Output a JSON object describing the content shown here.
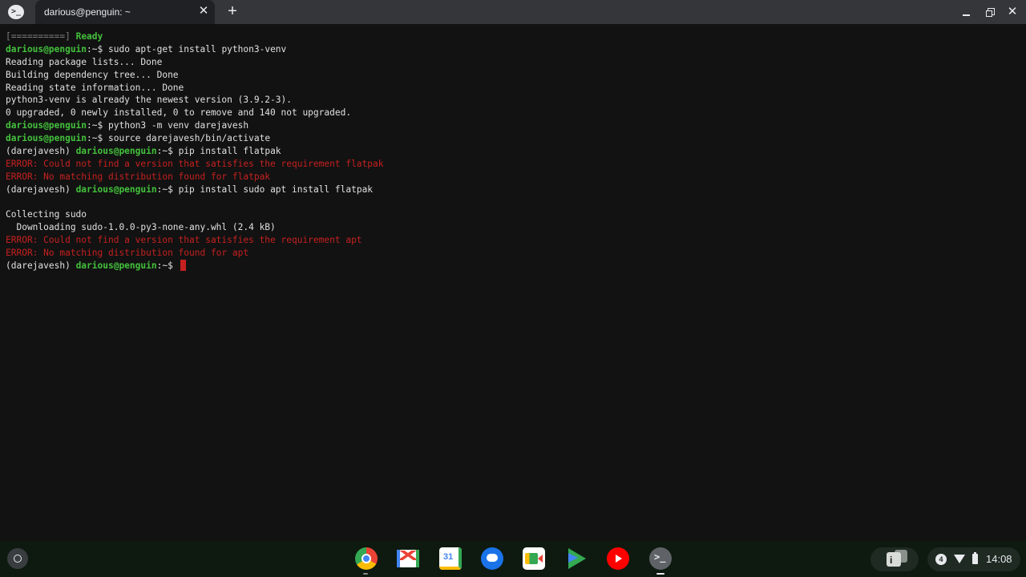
{
  "window": {
    "app_icon_glyph": ">_",
    "tab_title": "darious@penguin: ~",
    "tab_close_glyph": "✕",
    "new_tab_glyph": "+",
    "close_glyph": "✕"
  },
  "terminal": {
    "colors": {
      "green": "#43c13c",
      "red": "#c62020",
      "text": "#e0e0e0",
      "background": "#121212"
    },
    "lines": [
      {
        "progress": "[==========]",
        "status": "Ready"
      },
      {
        "user": "darious@penguin",
        "path": ":~$ ",
        "cmd": "sudo apt-get install python3-venv"
      },
      {
        "out": "Reading package lists... Done"
      },
      {
        "out": "Building dependency tree... Done"
      },
      {
        "out": "Reading state information... Done"
      },
      {
        "out": "python3-venv is already the newest version (3.9.2-3)."
      },
      {
        "out": "0 upgraded, 0 newly installed, 0 to remove and 140 not upgraded."
      },
      {
        "user": "darious@penguin",
        "path": ":~$ ",
        "cmd": "python3 -m venv darejavesh"
      },
      {
        "user": "darious@penguin",
        "path": ":~$ ",
        "cmd": "source darejavesh/bin/activate"
      },
      {
        "venv": "(darejavesh) ",
        "user": "darious@penguin",
        "path": ":~$ ",
        "cmd": "pip install flatpak"
      },
      {
        "err": "ERROR: Could not find a version that satisfies the requirement flatpak"
      },
      {
        "err": "ERROR: No matching distribution found for flatpak"
      },
      {
        "venv": "(darejavesh) ",
        "user": "darious@penguin",
        "path": ":~$ ",
        "cmd": "pip install sudo apt install flatpak"
      },
      {
        "out": ""
      },
      {
        "out": "Collecting sudo"
      },
      {
        "out": "  Downloading sudo-1.0.0-py3-none-any.whl (2.4 kB)"
      },
      {
        "err": "ERROR: Could not find a version that satisfies the requirement apt"
      },
      {
        "err": "ERROR: No matching distribution found for apt"
      },
      {
        "venv": "(darejavesh) ",
        "user": "darious@penguin",
        "path": ":~$ ",
        "cmd": "",
        "cursor": true
      }
    ]
  },
  "shelf": {
    "apps": [
      "chrome-icon",
      "gmail-icon",
      "calendar-icon",
      "messages-icon",
      "meet-icon",
      "play-store-icon",
      "youtube-icon",
      "terminal-icon"
    ],
    "calendar_day": "31",
    "terminal_glyph": ">_",
    "tote_glyph": "i",
    "notification_count": "4",
    "time": "14:08"
  }
}
